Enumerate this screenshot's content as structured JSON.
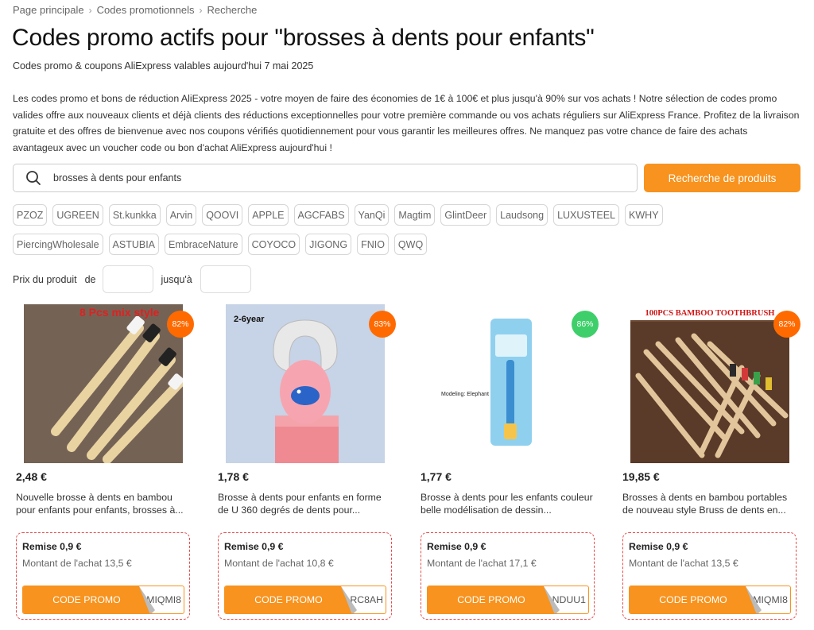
{
  "breadcrumb": [
    "Page principale",
    "Codes promotionnels",
    "Recherche"
  ],
  "page_title": "Codes promo actifs pour \"brosses à dents pour enfants\"",
  "subtitle": "Codes promo & coupons AliExpress valables aujourd'hui 7 mai 2025",
  "intro": "Les codes promo et bons de réduction AliExpress 2025 - votre moyen de faire des économies de 1€ à 100€ et plus jusqu'à 90% sur vos achats ! Notre sélection de codes promo valides offre aux nouveaux clients et déjà clients des réductions exceptionnelles pour votre première commande ou vos achats réguliers sur AliExpress France. Profitez de la livraison gratuite et des offres de bienvenue avec nos coupons vérifiés quotidiennement pour vous garantir les meilleures offres. Ne manquez pas votre chance de faire des achats avantageux avec un voucher code ou bon d'achat AliExpress aujourd'hui !",
  "search": {
    "value": "brosses à dents pour enfants",
    "button_label": "Recherche de produits"
  },
  "brands_row1": [
    "PZOZ",
    "UGREEN",
    "St.kunkka",
    "Arvin",
    "QOOVI",
    "APPLE",
    "AGCFABS",
    "YanQi",
    "Magtim",
    "GlintDeer",
    "Laudsong",
    "LUXUSTEEL",
    "KWHY"
  ],
  "brands_row2": [
    "PiercingWholesale",
    "ASTUBIA",
    "EmbraceNature",
    "COYOCO",
    "JIGONG",
    "FNIO",
    "QWQ"
  ],
  "price_filter": {
    "label": "Prix du produit",
    "from": "de",
    "to": "jusqu'à"
  },
  "colors": {
    "accent": "#f7931e",
    "discount_orange": "#ff6a00",
    "discount_green": "#3ecf6a",
    "coupon_border": "#e84a4a"
  },
  "products": [
    {
      "image_text": "8 Pcs mix style",
      "discount": "82%",
      "discount_color": "orange",
      "price": "2,48 €",
      "title": "Nouvelle brosse à dents en bambou pour enfants pour enfants, brosses à...",
      "remise": "Remise 0,9 €",
      "montant": "Montant de l'achat 13,5 €",
      "promo_label": "CODE PROMO",
      "code": "MIQMI8"
    },
    {
      "image_text": "2-6year",
      "discount": "83%",
      "discount_color": "orange",
      "price": "1,78 €",
      "title": "Brosse à dents pour enfants en forme de U 360 degrés de dents pour...",
      "remise": "Remise 0,9 €",
      "montant": "Montant de l'achat 10,8 €",
      "promo_label": "CODE PROMO",
      "code": "RC8AH"
    },
    {
      "image_text": "Modeling: Elephant",
      "discount": "86%",
      "discount_color": "green",
      "price": "1,77 €",
      "title": "Brosse à dents pour les enfants couleur belle modélisation de dessin...",
      "remise": "Remise 0,9 €",
      "montant": "Montant de l'achat 17,1 €",
      "promo_label": "CODE PROMO",
      "code": "NDUU1"
    },
    {
      "image_text": "100PCS BAMBOO TOOTHBRUSH",
      "discount": "82%",
      "discount_color": "orange",
      "price": "19,85 €",
      "title": "Brosses à dents en bambou portables de nouveau style Bruss de dents en...",
      "remise": "Remise 0,9 €",
      "montant": "Montant de l'achat 13,5 €",
      "promo_label": "CODE PROMO",
      "code": "MIQMI8"
    }
  ]
}
